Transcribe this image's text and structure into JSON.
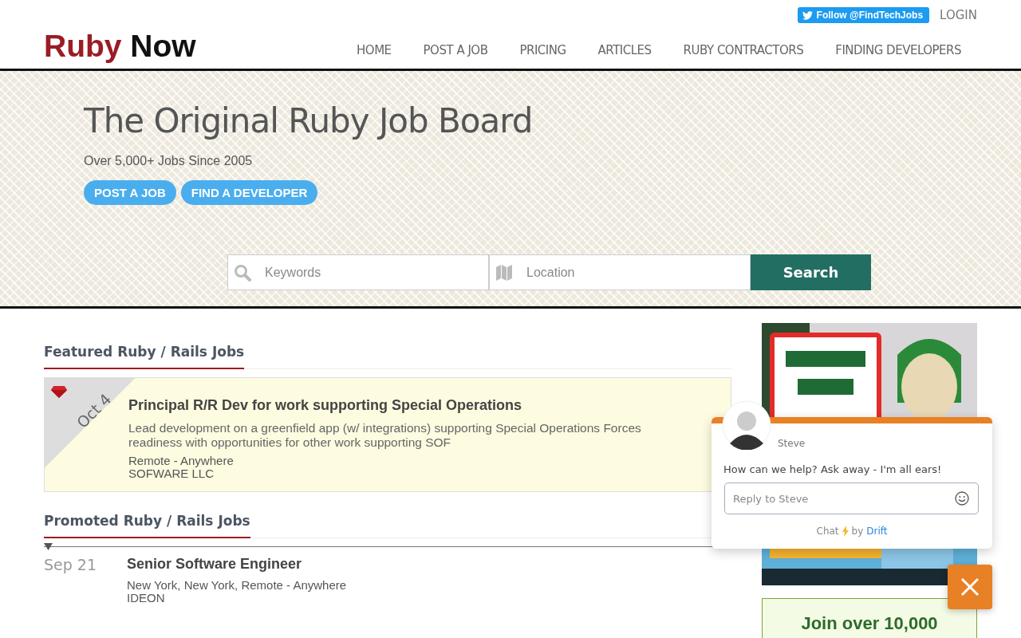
{
  "header": {
    "twitter_button": "Follow @FindTechJobs",
    "login": "LOGIN",
    "logo": {
      "first": "Ruby",
      "second": "Now"
    },
    "nav": [
      "HOME",
      "POST A JOB",
      "PRICING",
      "ARTICLES",
      "RUBY CONTRACTORS",
      "FINDING DEVELOPERS"
    ]
  },
  "hero": {
    "title": "The Original Ruby Job Board",
    "subtitle": "Over 5,000+ Jobs Since 2005",
    "buttons": [
      "POST A JOB",
      "FIND A DEVELOPER"
    ],
    "search": {
      "keywords_placeholder": "Keywords",
      "location_placeholder": "Location",
      "button": "Search"
    }
  },
  "featured": {
    "heading": "Featured Ruby / Rails Jobs",
    "jobs": [
      {
        "date": "Oct 4",
        "title": "Principal R/R Dev for work supporting Special Operations",
        "description": "Lead development on a greenfield app (w/ integrations) supporting Special Operations Forces readiness with opportunities for other work supporting SOF",
        "location": "Remote - Anywhere",
        "company": "SOFWARE LLC"
      }
    ]
  },
  "promoted": {
    "heading": "Promoted Ruby / Rails Jobs",
    "jobs": [
      {
        "date": "Sep 21",
        "title": "Senior Software Engineer",
        "location": "New York, New York, Remote - Anywhere",
        "company": "IDEON"
      }
    ]
  },
  "sidebar": {
    "signup": "Join over 10,000"
  },
  "chat": {
    "agent": "Steve",
    "message": "How can we help? Ask away - I'm all ears!",
    "reply_placeholder": "Reply to Steve",
    "footer_prefix": "Chat",
    "footer_by": "by",
    "footer_brand": "Drift"
  }
}
